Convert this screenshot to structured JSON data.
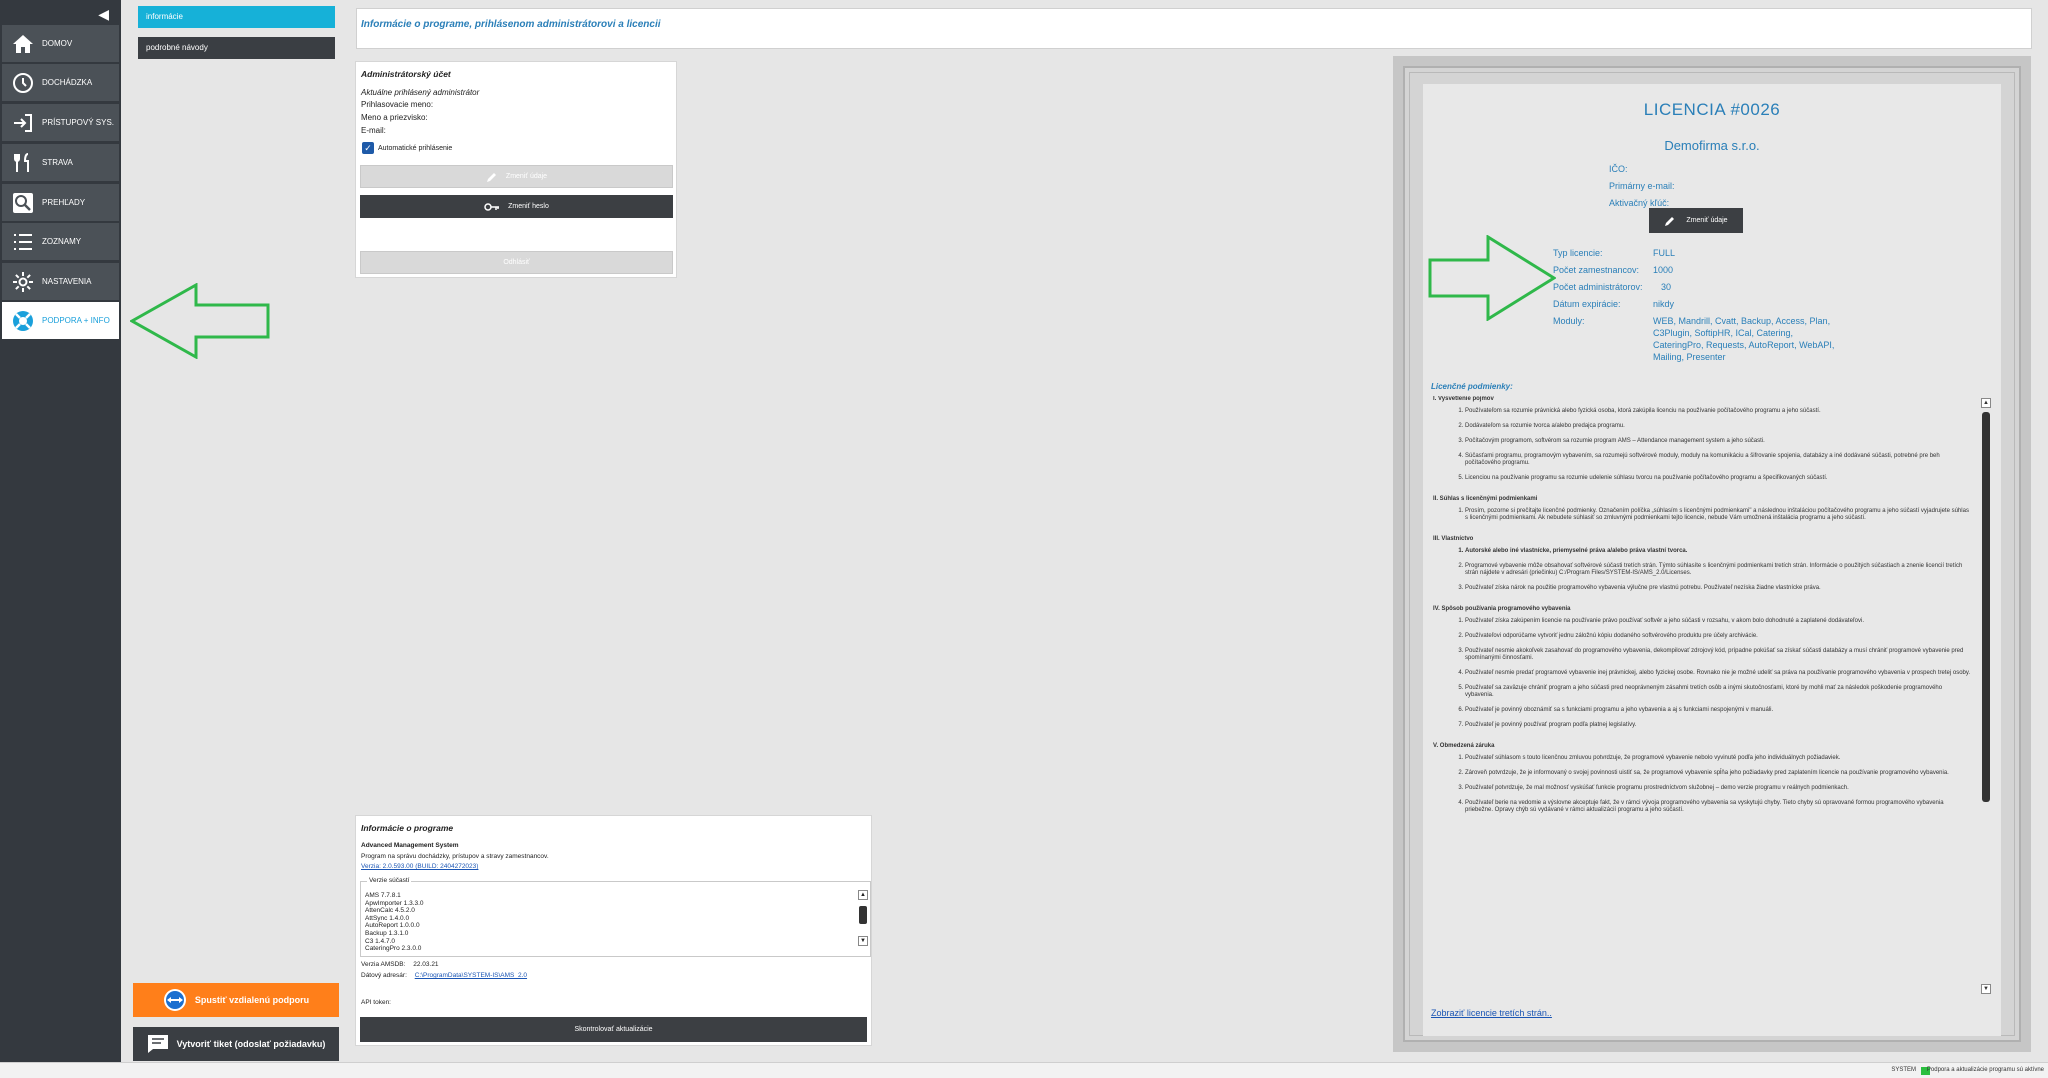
{
  "nav": {
    "items": [
      {
        "label": "DOMOV",
        "icon": "home-icon"
      },
      {
        "label": "DOCHÁDZKA",
        "icon": "clock-icon"
      },
      {
        "label": "PRÍSTUPOVÝ SYS.",
        "icon": "login-icon"
      },
      {
        "label": "STRAVA",
        "icon": "cutlery-icon"
      },
      {
        "label": "PREHĽADY",
        "icon": "search-icon"
      },
      {
        "label": "ZOZNAMY",
        "icon": "list-icon"
      },
      {
        "label": "NASTAVENIA",
        "icon": "gear-icon"
      },
      {
        "label": "PODPORA + INFO",
        "icon": "lifebuoy-icon"
      }
    ]
  },
  "submenu": {
    "items": [
      "informácie",
      "podrobné návody"
    ]
  },
  "support": {
    "remote_label": "Spustiť vzdialenú podporu",
    "ticket_label": "Vytvoriť tiket (odoslať požiadavku)"
  },
  "header": {
    "title": "Informácie o programe, prihlásenom administrátorovi a licencii"
  },
  "admin": {
    "title": "Administrátorský účet",
    "subtitle": "Aktuálne prihlásený administrátor",
    "login_label": "Prihlasovacie meno:",
    "name_label": "Meno a priezvisko:",
    "email_label": "E-mail:",
    "autologin_label": "Automatické prihlásenie",
    "edit_label": "Zmeniť údaje",
    "password_label": "Zmeniť heslo",
    "logout_label": "Odhlásiť"
  },
  "program": {
    "title": "Informácie o programe",
    "name": "Advanced Management System",
    "description": "Program na správu dochádzky, prístupov a stravy zamestnancov.",
    "version_link": "Verzia: 2.0.593.00 (BUILD: 2404272023)",
    "components_legend": "Verzie súčastí",
    "components": [
      "AMS 7.7.8.1",
      "ApwImporter 1.3.3.0",
      "AttenCalc 4.5.2.0",
      "AttSync 1.4.0.0",
      "AutoReport 1.0.0.0",
      "Backup 1.3.1.0",
      "C3 1.4.7.0",
      "CateringPro 2.3.0.0"
    ],
    "amsdb_label": "Verzia AMSDB:",
    "amsdb_value": "22.03.21",
    "data_dir_label": "Dátový adresár:",
    "data_dir_value": "C:\\ProgramData\\SYSTEM-IS\\AMS_2.0",
    "api_token_label": "API token:",
    "update_label": "Skontrolovať aktualizácie"
  },
  "licence": {
    "title": "LICENCIA #0026",
    "company": "Demofirma s.r.o.",
    "ico_label": "IČO:",
    "email_label": "Primárny e-mail:",
    "key_label": "Aktivačný kľúč:",
    "edit_label": "Zmeniť údaje",
    "type_label": "Typ licencie:",
    "type_value": "FULL",
    "employees_label": "Počet zamestnancov:",
    "employees_value": "1000",
    "admins_label": "Počet administrátorov:",
    "admins_value": "30",
    "expiry_label": "Dátum expirácie:",
    "expiry_value": "nikdy",
    "modules_label": "Moduly:",
    "modules_lines": [
      "WEB, Mandrill, Cvatt, Backup, Access, Plan,",
      "C3Plugin, SoftipHR, ICal, Catering,",
      "CateringPro, Requests, AutoReport, WebAPI,",
      "Mailing, Presenter"
    ],
    "terms_title": "Licenčné podmienky:",
    "third_party_link": "Zobraziť licencie tretích strán..",
    "sections": [
      {
        "title": "I. Vysvetlenie pojmov",
        "items": [
          "Používateľom sa rozumie právnická alebo fyzická osoba, ktorá zakúpila licenciu na používanie počítačového programu a jeho súčastí.",
          "Dodávateľom sa rozumie tvorca a/alebo predajca programu.",
          "Počítačovým programom, softvérom sa rozumie program AMS – Attendance management system a jeho súčasti.",
          "Súčasťami programu, programovým vybavením, sa rozumejú softvérové moduly, moduly na komunikáciu a šifrovanie spojenia, databázy a iné dodávané súčasti, potrebné pre beh počítačového programu.",
          "Licenciou na používanie programu sa rozumie udelenie súhlasu tvorcu na používanie počítačového programu a špecifikovaných súčastí."
        ]
      },
      {
        "title": "II. Súhlas s licenčnými podmienkami",
        "items": [
          "Prosím, pozorne si prečítajte licenčné podmienky. Označením políčka „súhlasím s licenčnými podmienkami\" a následnou inštaláciou počítačového programu a jeho súčastí vyjadrujete súhlas s licenčnými podmienkami. Ak nebudete súhlasiť so zmluvnými podmienkami tejto licencie, nebude Vám umožnená inštalácia programu a jeho súčastí."
        ]
      },
      {
        "title": "III. Vlastníctvo",
        "items": [
          "Autorské alebo iné vlastnícke, priemyselné práva a/alebo práva vlastní tvorca.",
          "Programové vybavenie môže obsahovať softvérové súčasti tretích strán. Týmto súhlasíte s licenčnými podmienkami tretích strán. Informácie o použitých súčastiach a znenie licencií tretích strán nájdete v adresári (priečinku) C:/Program Files/SYSTEM-IS/AMS_2.0/Licenses.",
          "Používateľ získa nárok na použitie programového vybavenia výlučne pre vlastnú potrebu. Používateľ nezíska žiadne vlastnícke práva."
        ]
      },
      {
        "title": "IV. Spôsob používania programového vybavenia",
        "items": [
          "Používateľ získa zakúpením licencie na používanie právo používať softvér a jeho súčasti v rozsahu, v akom bolo dohodnuté a zaplatené dodávateľovi.",
          "Používateľovi odporúčame vytvoriť jednu záložnú kópiu dodaného softvérového produktu pre účely archivácie.",
          "Používateľ nesmie akokoľvek zasahovať do programového vybavenia, dekompilovať zdrojový kód, prípadne pokúšať sa získať súčasti databázy a musí chrániť programové vybavenie pred spomínanými činnosťami.",
          "Používateľ nesmie predať programové vybavenie inej právnickej, alebo fyzickej osobe. Rovnako nie je možné udeliť sa práva na používanie programového vybavenia v prospech tretej osoby.",
          "Používateľ sa zaväzuje chrániť program a jeho súčasti pred neoprávneným zásahmi tretích osôb a inými skutočnosťami, ktoré by mohli mať za následok poškodenie programového vybavenia.",
          "Používateľ je povinný oboznámiť sa s funkciami programu a jeho vybavenia a aj s funkciami nespojenými v manuáli.",
          "Používateľ je povinný používať program podľa platnej legislatívy."
        ]
      },
      {
        "title": "V. Obmedzená záruka",
        "items": [
          "Používateľ súhlasom s touto licenčnou zmluvou potvrdzuje, že programové vybavenie nebolo vyvinuté podľa jeho individuálnych požiadaviek.",
          "Zároveň potvrdzuje, že je informovaný o svojej povinnosti uistiť sa, že programové vybavenie spĺňa jeho požiadavky pred zaplatením licencie na používanie programového vybavenia.",
          "Používateľ potvrdzuje, že mal možnosť vyskúšať funkcie programu prostredníctvom služobnej – demo verzie programu v reálnych podmienkach.",
          "Používateľ berie na vedomie a výslovne akceptuje fakt, že v rámci vývoja programového vybavenia sa vyskytujú chyby. Tieto chyby sú opravované formou programového vybavenia priebežne. Opravy chýb sú vydávané v rámci aktualizácií programu a jeho súčastí."
        ]
      }
    ]
  },
  "status": {
    "system": "SYSTEM",
    "message": "Podpora a aktualizácie programu sú aktívne"
  },
  "colors": {
    "accent": "#16b1d8",
    "orange": "#ff7f1a",
    "arrow": "#2fb84a",
    "nav": "#34393f"
  }
}
